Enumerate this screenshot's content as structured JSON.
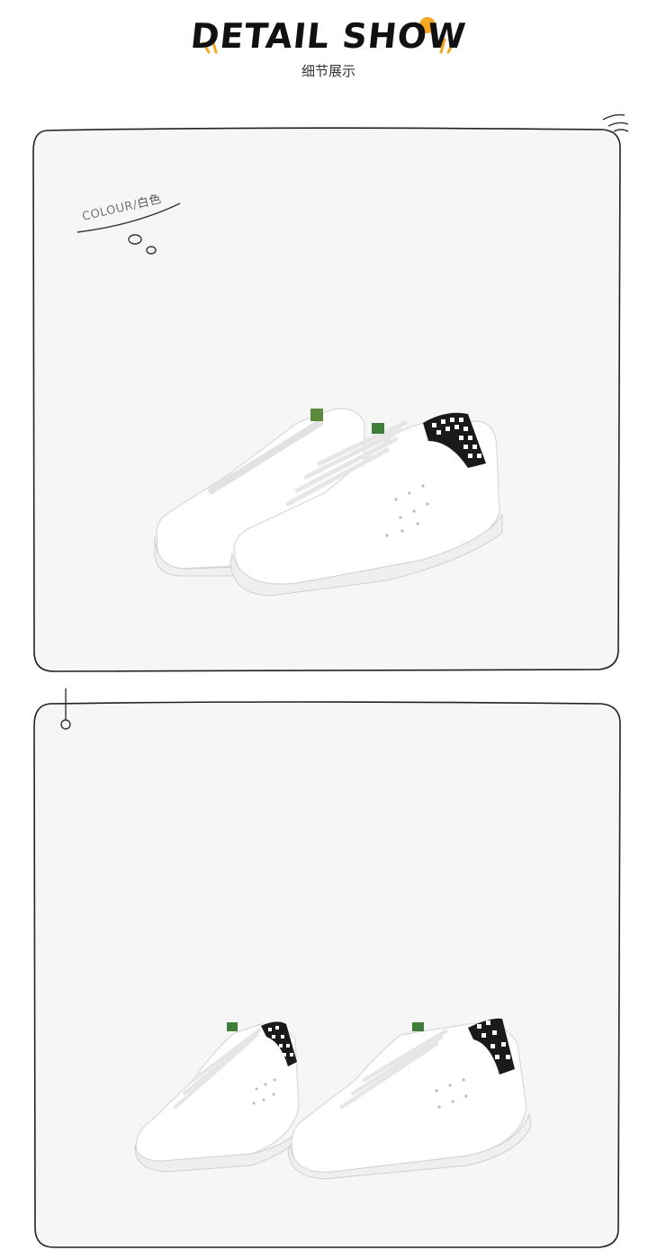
{
  "header": {
    "title": "DETAIL SHOW",
    "subtitle": "细节展示"
  },
  "panels": [
    {
      "colour_label": "COLOUR",
      "colour_separator": "/",
      "colour_value": "白色",
      "image": "pair-of-white-sneakers-front-view"
    },
    {
      "image": "pair-of-white-sneakers-side-view"
    }
  ],
  "colors": {
    "panel_bg": "#f6f6f6",
    "line": "#222222",
    "accent": "#f5a623",
    "checker": "#111111"
  }
}
